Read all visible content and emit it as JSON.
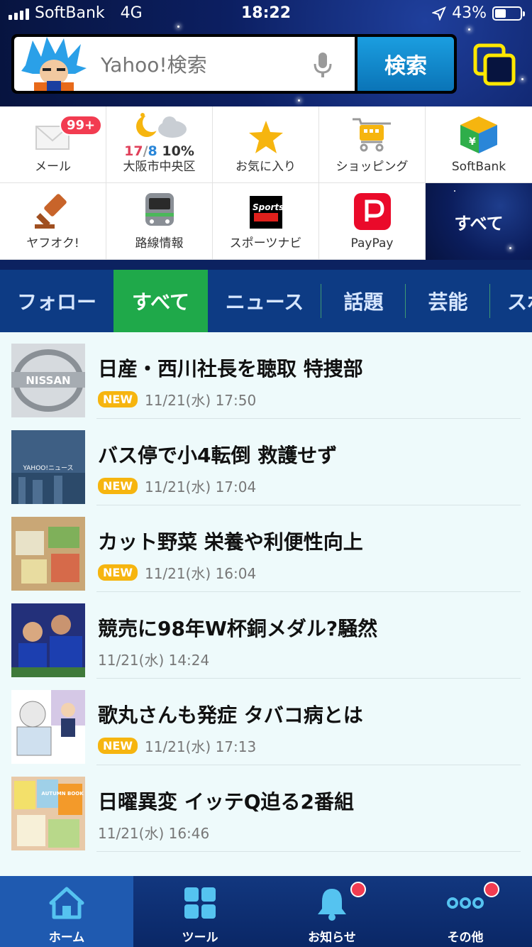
{
  "status": {
    "carrier": "SoftBank",
    "network": "4G",
    "time": "18:22",
    "battery": "43%",
    "battery_level": 0.43
  },
  "search": {
    "placeholder": "Yahoo!検索",
    "button": "検索"
  },
  "tools": [
    {
      "label": "メール",
      "badge": "99+",
      "icon": "mail-icon"
    },
    {
      "label": "大阪市中央区",
      "temp_high": "17",
      "temp_low": "8",
      "rain": "10%",
      "icon": "weather-icon"
    },
    {
      "label": "お気に入り",
      "icon": "star-icon"
    },
    {
      "label": "ショッピング",
      "icon": "cart-icon"
    },
    {
      "label": "SoftBank",
      "icon": "softbank-cube-icon"
    },
    {
      "label": "ヤフオク!",
      "icon": "auction-hammer-icon"
    },
    {
      "label": "路線情報",
      "icon": "train-icon"
    },
    {
      "label": "スポーツナビ",
      "icon": "sportsnavi-icon"
    },
    {
      "label": "PayPay",
      "icon": "paypay-icon"
    },
    {
      "label": "すべて"
    }
  ],
  "sportsnavi_logo_text": "Sports navi",
  "categories": [
    "フォロー",
    "すべて",
    "ニュース",
    "話題",
    "芸能",
    "スポーツ"
  ],
  "news": [
    {
      "title": "日産・西川社長を聴取 特捜部",
      "new": "NEW",
      "date": "11/21(水) 17:50",
      "thumb_text": "NISSAN"
    },
    {
      "title": "バス停で小4転倒 救護せず",
      "new": "NEW",
      "date": "11/21(水) 17:04",
      "thumb_text": "YAHOO!ニュース"
    },
    {
      "title": "カット野菜 栄養や利便性向上",
      "new": "NEW",
      "date": "11/21(水) 16:04"
    },
    {
      "title": "競売に98年W杯銅メダル?騒然",
      "new": "",
      "date": "11/21(水) 14:24"
    },
    {
      "title": "歌丸さんも発症 タバコ病とは",
      "new": "NEW",
      "date": "11/21(水) 17:13"
    },
    {
      "title": "日曜異変 イッテQ迫る2番組",
      "new": "",
      "date": "11/21(水) 16:46",
      "thumb_text": "AUTUMN BOOK 2018"
    }
  ],
  "nav": [
    {
      "label": "ホーム",
      "icon": "home-icon"
    },
    {
      "label": "ツール",
      "icon": "grid-icon"
    },
    {
      "label": "お知らせ",
      "icon": "bell-icon"
    },
    {
      "label": "その他",
      "icon": "more-icon"
    }
  ]
}
